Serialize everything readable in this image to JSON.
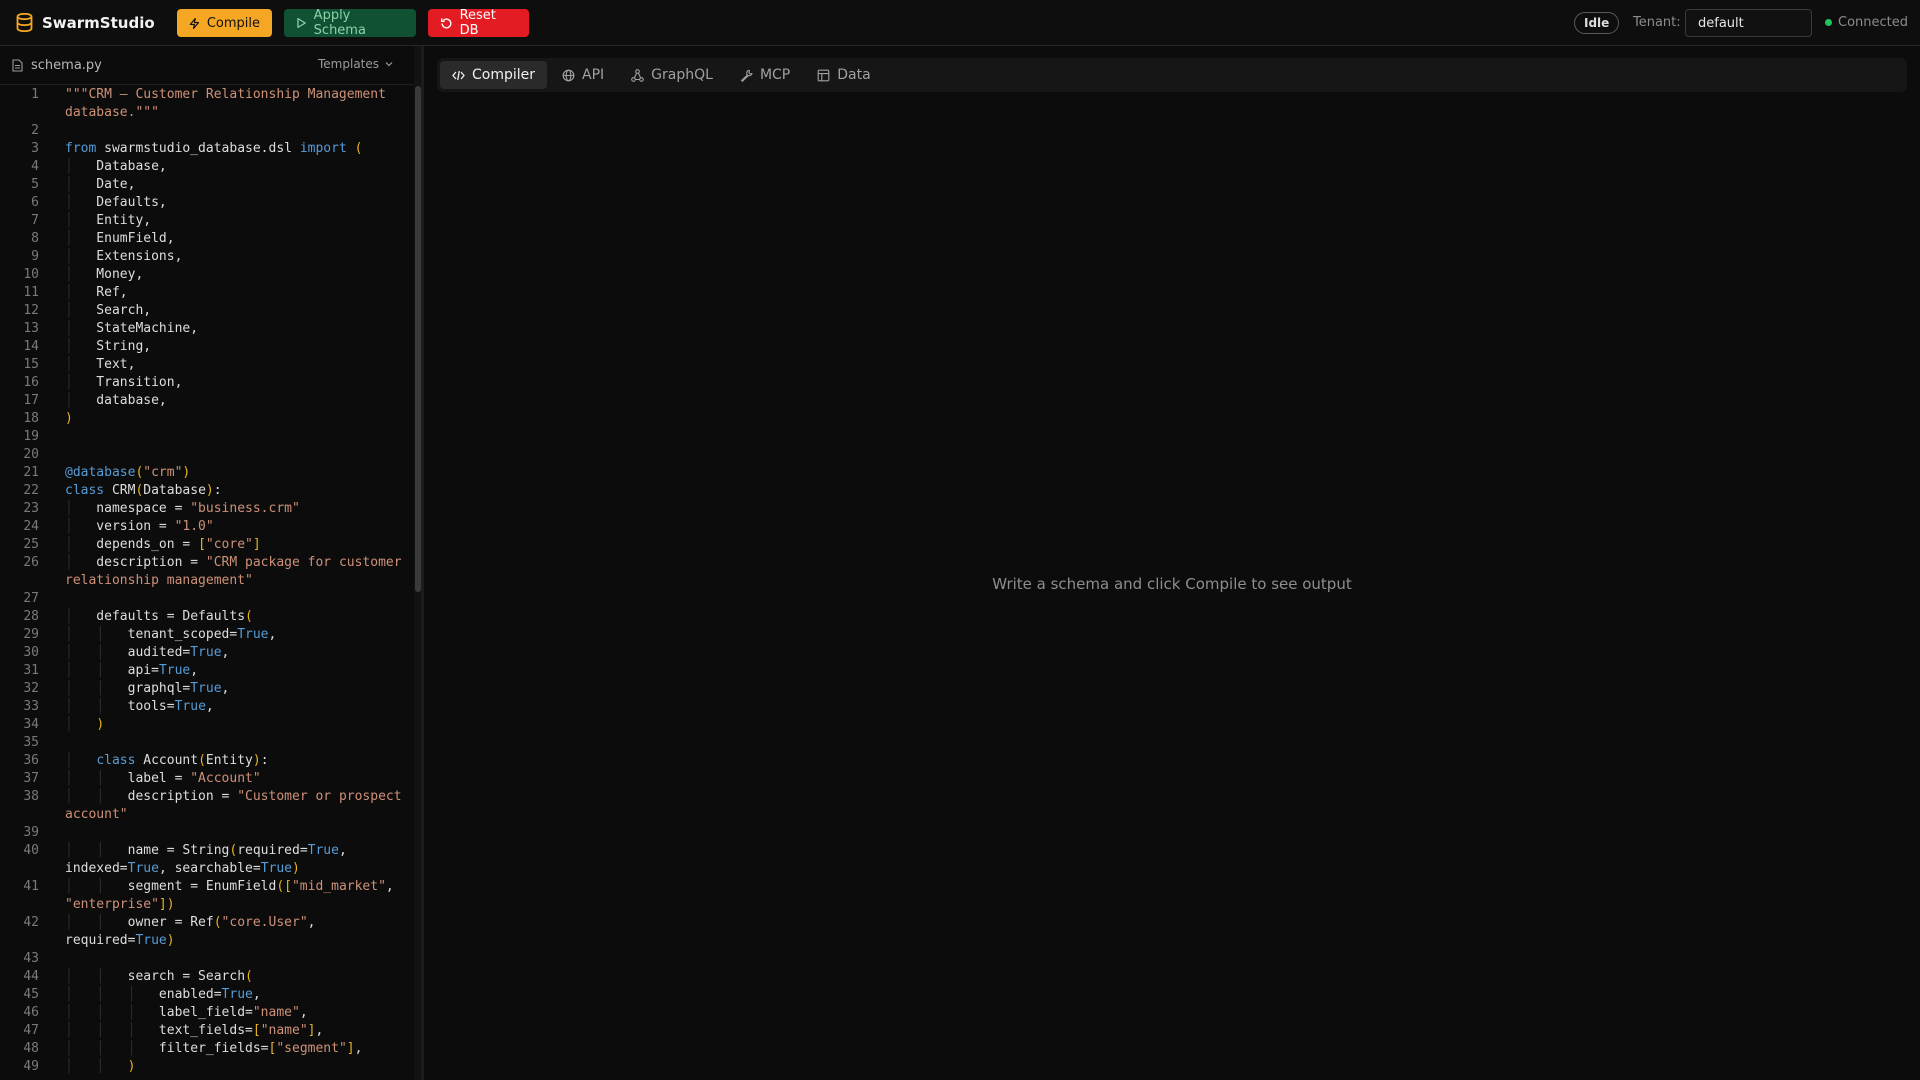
{
  "app": {
    "title": "SwarmStudio"
  },
  "toolbar": {
    "compile_label": "Compile",
    "apply_label": "Apply Schema",
    "reset_label": "Reset DB",
    "status": "Idle",
    "tenant_label": "Tenant:",
    "tenant_value": "default",
    "connection_status": "Connected"
  },
  "editor": {
    "file_name": "schema.py",
    "templates_label": "Templates"
  },
  "tabs": [
    {
      "label": "Compiler",
      "icon": "code-icon",
      "active": true
    },
    {
      "label": "API",
      "icon": "globe-icon",
      "active": false
    },
    {
      "label": "GraphQL",
      "icon": "graph-icon",
      "active": false
    },
    {
      "label": "MCP",
      "icon": "wrench-icon",
      "active": false
    },
    {
      "label": "Data",
      "icon": "table-icon",
      "active": false
    }
  ],
  "output": {
    "empty_message": "Write a schema and click Compile to see output"
  },
  "colors": {
    "compile": "#f5a623",
    "apply": "#0f5132",
    "reset": "#e31b23",
    "connected": "#22c55e"
  },
  "code_lines": [
    "\"\"\"CRM — Customer Relationship Management database.\"\"\"",
    "",
    "from swarmstudio_database.dsl import (",
    "    Database,",
    "    Date,",
    "    Defaults,",
    "    Entity,",
    "    EnumField,",
    "    Extensions,",
    "    Money,",
    "    Ref,",
    "    Search,",
    "    StateMachine,",
    "    String,",
    "    Text,",
    "    Transition,",
    "    database,",
    ")",
    "",
    "",
    "@database(\"crm\")",
    "class CRM(Database):",
    "    namespace = \"business.crm\"",
    "    version = \"1.0\"",
    "    depends_on = [\"core\"]",
    "    description = \"CRM package for customer relationship management\"",
    "",
    "    defaults = Defaults(",
    "        tenant_scoped=True,",
    "        audited=True,",
    "        api=True,",
    "        graphql=True,",
    "        tools=True,",
    "    )",
    "",
    "    class Account(Entity):",
    "        label = \"Account\"",
    "        description = \"Customer or prospect account\"",
    "",
    "        name = String(required=True, indexed=True, searchable=True)",
    "        segment = EnumField([\"mid_market\", \"enterprise\"])",
    "        owner = Ref(\"core.User\", required=True)",
    "",
    "        search = Search(",
    "            enabled=True,",
    "            label_field=\"name\",",
    "            text_fields=[\"name\"],",
    "            filter_fields=[\"segment\"],",
    "        )"
  ]
}
